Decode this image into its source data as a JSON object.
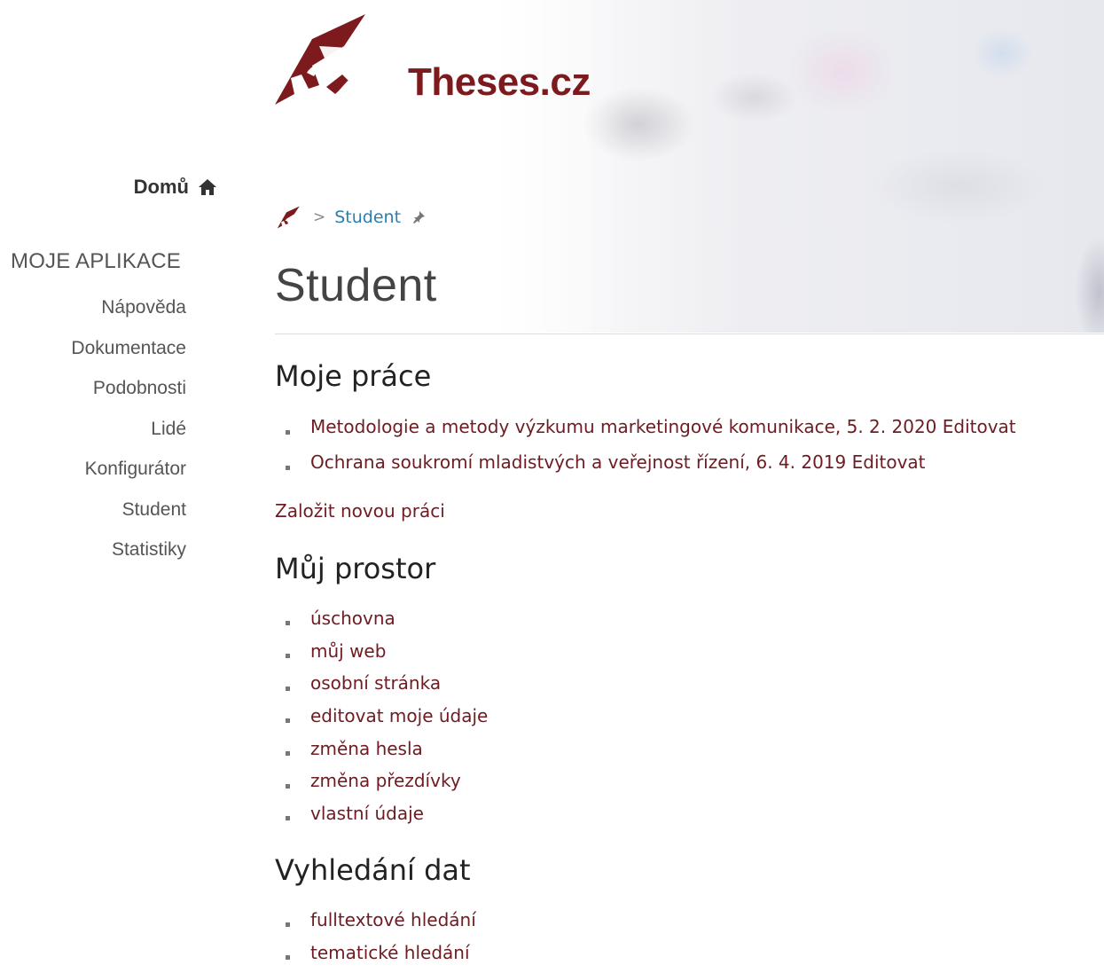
{
  "brand": {
    "name": "Theses.cz",
    "color": "#7d1a1d"
  },
  "sidebar": {
    "home_label": "Domů",
    "home_icon": "home-icon",
    "heading": "MOJE APLIKACE",
    "items": [
      {
        "label": "Nápověda"
      },
      {
        "label": "Dokumentace"
      },
      {
        "label": "Podobnosti"
      },
      {
        "label": "Lidé"
      },
      {
        "label": "Konfigurátor"
      },
      {
        "label": "Student"
      },
      {
        "label": "Statistiky"
      }
    ]
  },
  "breadcrumb": {
    "home_icon": "logo-icon",
    "current": "Student",
    "pin_icon": "pin-icon"
  },
  "page": {
    "title": "Student"
  },
  "sections": {
    "my_works": {
      "heading": "Moje práce",
      "items": [
        {
          "text": "Metodologie a metody výzkumu marketingové komunikace, 5. 2. 2020 Editovat"
        },
        {
          "text": "Ochrana soukromí mladistvých a veřejnost řízení, 6. 4. 2019 Editovat"
        }
      ],
      "new_work_link": "Založit novou práci"
    },
    "my_space": {
      "heading": "Můj prostor",
      "items": [
        {
          "text": "úschovna"
        },
        {
          "text": "můj web"
        },
        {
          "text": "osobní stránka"
        },
        {
          "text": "editovat moje údaje"
        },
        {
          "text": "změna hesla"
        },
        {
          "text": "změna přezdívky"
        },
        {
          "text": "vlastní údaje"
        }
      ]
    },
    "data_search": {
      "heading": "Vyhledání dat",
      "items": [
        {
          "text": "fulltextové hledání"
        },
        {
          "text": "tematické hledání"
        }
      ]
    }
  },
  "colors": {
    "link": "#6e1c22",
    "breadcrumb_link": "#2a7eb0",
    "text": "#333333"
  }
}
